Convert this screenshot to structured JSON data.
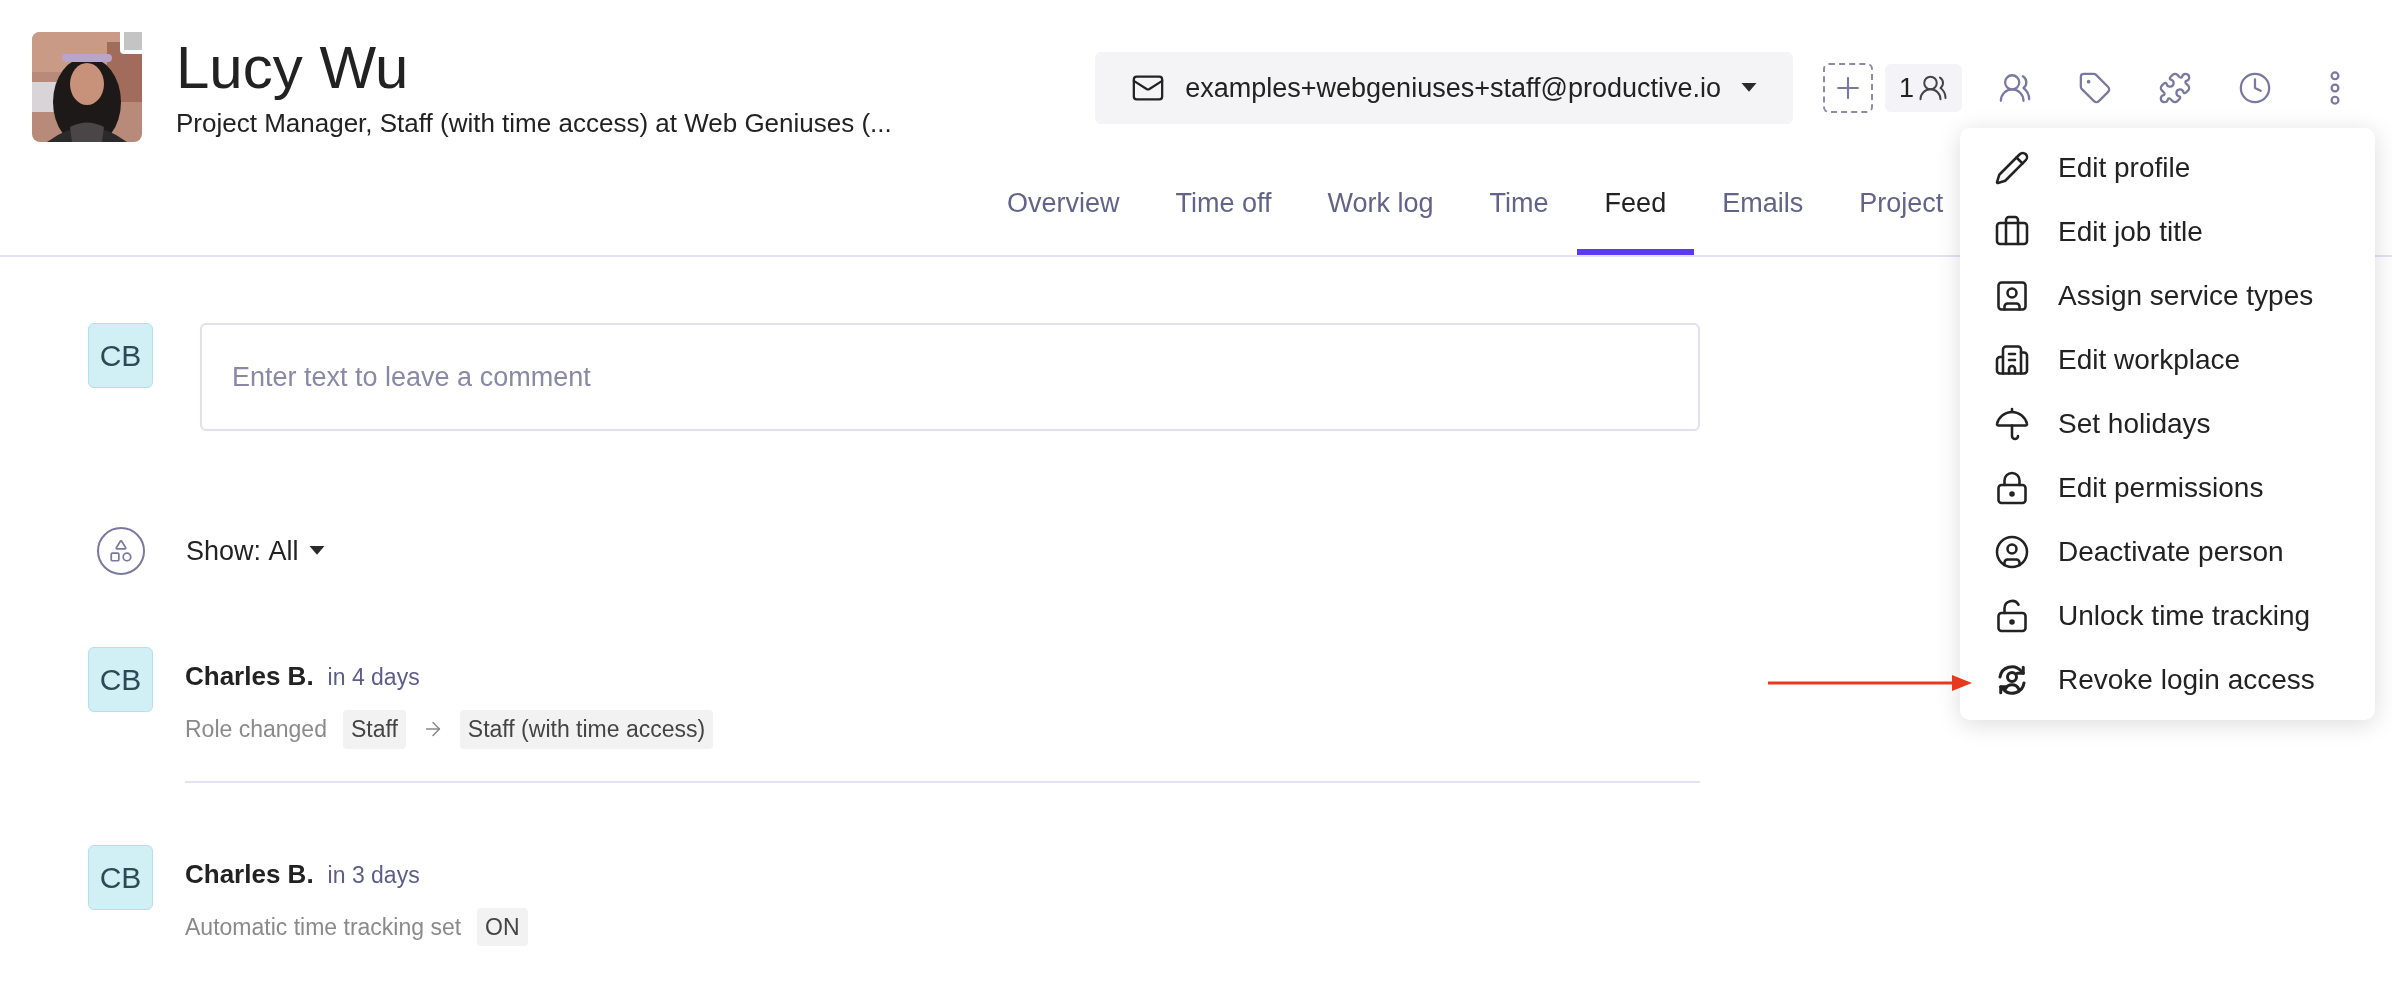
{
  "profile": {
    "name": "Lucy Wu",
    "subtitle": "Project Manager, Staff (with time access) at Web Geniuses (..."
  },
  "email_selector": {
    "value": "examples+webgeniuses+staff@productive.io"
  },
  "people_count": "1",
  "tabs": [
    {
      "label": "Overview",
      "selected": false
    },
    {
      "label": "Time off",
      "selected": false
    },
    {
      "label": "Work log",
      "selected": false
    },
    {
      "label": "Time",
      "selected": false
    },
    {
      "label": "Feed",
      "selected": true
    },
    {
      "label": "Emails",
      "selected": false
    },
    {
      "label": "Project",
      "selected": false
    }
  ],
  "comment": {
    "avatar": "CB",
    "placeholder": "Enter text to leave a comment"
  },
  "filter": {
    "label": "Show:",
    "value": "All"
  },
  "feed": [
    {
      "kind": "change",
      "avatar": "CB",
      "author": "Charles B.",
      "time": "in 4 days",
      "action": "Role changed",
      "from": "Staff",
      "to": "Staff (with time access)"
    },
    {
      "kind": "setting",
      "avatar": "CB",
      "author": "Charles B.",
      "time": "in 3 days",
      "action": "Automatic time tracking set",
      "value": "ON"
    }
  ],
  "menu": {
    "items": [
      {
        "label": "Edit profile"
      },
      {
        "label": "Edit job title"
      },
      {
        "label": "Assign service types"
      },
      {
        "label": "Edit workplace"
      },
      {
        "label": "Set holidays"
      },
      {
        "label": "Edit permissions"
      },
      {
        "label": "Deactivate person"
      },
      {
        "label": "Unlock time tracking"
      },
      {
        "label": "Revoke login access"
      }
    ]
  }
}
